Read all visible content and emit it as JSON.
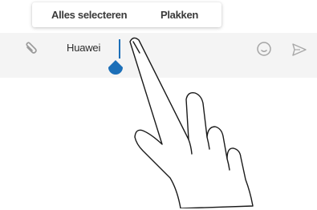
{
  "context_menu": {
    "select_all_label": "Alles selecteren",
    "paste_label": "Plakken"
  },
  "input_bar": {
    "text_value": "Huawei",
    "icons": {
      "attach": "paperclip-icon",
      "emoji": "emoji-icon",
      "send": "send-icon"
    }
  },
  "colors": {
    "accent": "#1c6fb8",
    "bar_background": "#f4f4f4",
    "menu_text": "#3a3a3a"
  }
}
